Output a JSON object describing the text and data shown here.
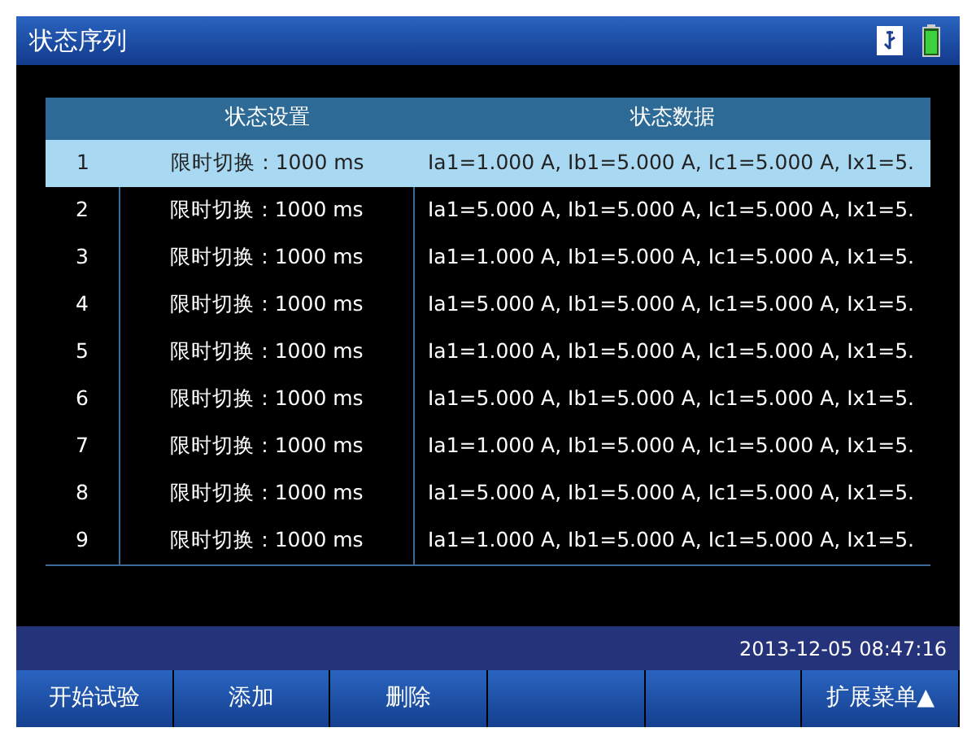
{
  "window": {
    "title": "状态序列"
  },
  "table": {
    "columns": [
      "状态设置",
      "状态数据"
    ],
    "rows": [
      {
        "index": "1",
        "setting": "限时切换 : 1000 ms",
        "data": "Ia1=1.000 A, Ib1=5.000 A, Ic1=5.000 A, Ix1=5.",
        "selected": true
      },
      {
        "index": "2",
        "setting": "限时切换 : 1000 ms",
        "data": "Ia1=5.000 A, Ib1=5.000 A, Ic1=5.000 A, Ix1=5.",
        "selected": false
      },
      {
        "index": "3",
        "setting": "限时切换 : 1000 ms",
        "data": "Ia1=1.000 A, Ib1=5.000 A, Ic1=5.000 A, Ix1=5.",
        "selected": false
      },
      {
        "index": "4",
        "setting": "限时切换 : 1000 ms",
        "data": "Ia1=5.000 A, Ib1=5.000 A, Ic1=5.000 A, Ix1=5.",
        "selected": false
      },
      {
        "index": "5",
        "setting": "限时切换 : 1000 ms",
        "data": "Ia1=1.000 A, Ib1=5.000 A, Ic1=5.000 A, Ix1=5.",
        "selected": false
      },
      {
        "index": "6",
        "setting": "限时切换 : 1000 ms",
        "data": "Ia1=5.000 A, Ib1=5.000 A, Ic1=5.000 A, Ix1=5.",
        "selected": false
      },
      {
        "index": "7",
        "setting": "限时切换 : 1000 ms",
        "data": "Ia1=1.000 A, Ib1=5.000 A, Ic1=5.000 A, Ix1=5.",
        "selected": false
      },
      {
        "index": "8",
        "setting": "限时切换 : 1000 ms",
        "data": "Ia1=5.000 A, Ib1=5.000 A, Ic1=5.000 A, Ix1=5.",
        "selected": false
      },
      {
        "index": "9",
        "setting": "限时切换 : 1000 ms",
        "data": "Ia1=1.000 A, Ib1=5.000 A, Ic1=5.000 A, Ix1=5.",
        "selected": false
      }
    ]
  },
  "status_bar": {
    "datetime": "2013-12-05 08:47:16"
  },
  "softkeys": [
    {
      "kind": "labeled",
      "label": "开始试验"
    },
    {
      "kind": "labeled",
      "label": "添加"
    },
    {
      "kind": "labeled",
      "label": "删除"
    },
    {
      "kind": "blank"
    },
    {
      "kind": "blank"
    },
    {
      "kind": "labeled",
      "label": "扩展菜单▲"
    }
  ]
}
